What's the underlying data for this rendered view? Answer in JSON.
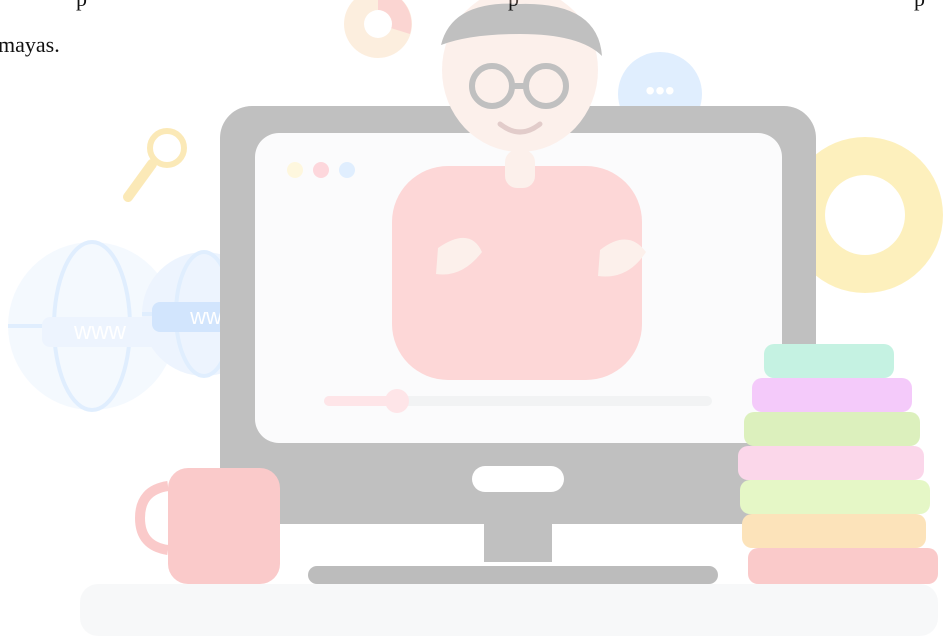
{
  "text": {
    "line1_fragments": [
      "p",
      "p",
      "p"
    ],
    "line2": "mayas."
  },
  "illustration": {
    "subject": "person in monitor",
    "url_label_left": "www",
    "url_label_right": "www",
    "chat_dots": "•••"
  },
  "colors": {
    "shirt": "#e85a4f",
    "frame": "#1a1a1a",
    "screen": "#e6e6e6",
    "progress": "#e9677a",
    "globe": "#1e88e5",
    "chat": "#3b82f6",
    "gear": "#f4b400"
  }
}
